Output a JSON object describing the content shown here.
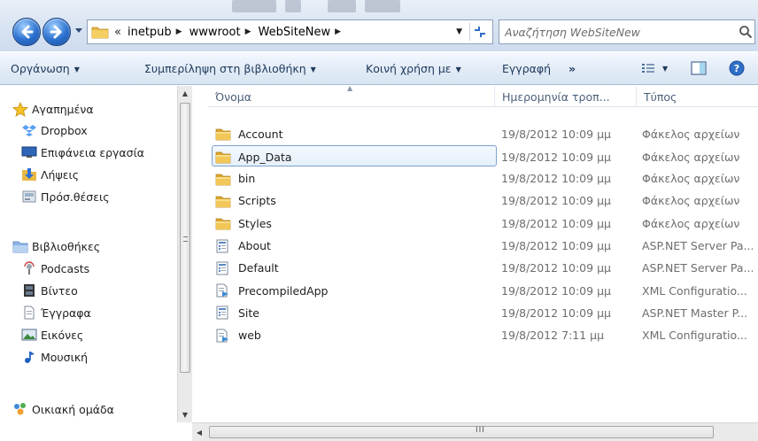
{
  "address": {
    "overflow": "«",
    "breadcrumbs": [
      "inetpub",
      "wwwroot",
      "WebSiteNew"
    ],
    "search_placeholder": "Αναζήτηση WebSiteNew"
  },
  "toolbar": {
    "organize": "Οργάνωση",
    "include_library": "Συμπερίληψη στη βιβλιοθήκη",
    "share_with": "Κοινή χρήση με",
    "burn": "Εγγραφή",
    "more": "»"
  },
  "sidebar": {
    "favorites": {
      "header": "Αγαπημένα",
      "items": [
        "Dropbox",
        "Επιφάνεια εργασία",
        "Λήψεις",
        "Πρόσ.θέσεις"
      ]
    },
    "libraries": {
      "header": "Βιβλιοθήκες",
      "items": [
        "Podcasts",
        "Βίντεο",
        "Έγγραφα",
        "Εικόνες",
        "Μουσική"
      ]
    },
    "homegroup": "Οικιακή ομάδα"
  },
  "columns": {
    "name": "Όνομα",
    "date": "Ημερομηνία τροπ...",
    "type": "Τύπος"
  },
  "files": [
    {
      "name": "Account",
      "date": "19/8/2012 10:09 μμ",
      "type": "Φάκελος αρχείων",
      "icon": "folder-icon"
    },
    {
      "name": "App_Data",
      "date": "19/8/2012 10:09 μμ",
      "type": "Φάκελος αρχείων",
      "icon": "folder-icon"
    },
    {
      "name": "bin",
      "date": "19/8/2012 10:09 μμ",
      "type": "Φάκελος αρχείων",
      "icon": "folder-icon"
    },
    {
      "name": "Scripts",
      "date": "19/8/2012 10:09 μμ",
      "type": "Φάκελος αρχείων",
      "icon": "folder-icon"
    },
    {
      "name": "Styles",
      "date": "19/8/2012 10:09 μμ",
      "type": "Φάκελος αρχείων",
      "icon": "folder-icon"
    },
    {
      "name": "About",
      "date": "19/8/2012 10:09 μμ",
      "type": "ASP.NET Server Pa...",
      "icon": "aspx-file-icon"
    },
    {
      "name": "Default",
      "date": "19/8/2012 10:09 μμ",
      "type": "ASP.NET Server Pa...",
      "icon": "aspx-file-icon"
    },
    {
      "name": "PrecompiledApp",
      "date": "19/8/2012 10:09 μμ",
      "type": "XML Configuratio...",
      "icon": "config-file-icon"
    },
    {
      "name": "Site",
      "date": "19/8/2012 10:09 μμ",
      "type": "ASP.NET Master P...",
      "icon": "master-file-icon"
    },
    {
      "name": "web",
      "date": "19/8/2012 7:11 μμ",
      "type": "XML Configuratio...",
      "icon": "config-file-icon"
    }
  ],
  "selected_row": "App_Data",
  "hscroll_glyph": "III",
  "colors": {
    "selection_border": "#7da2ce",
    "selection_fill": "#e6f0fa",
    "toolbar_text": "#1e395b",
    "secondary_text": "#6d6d6d"
  }
}
